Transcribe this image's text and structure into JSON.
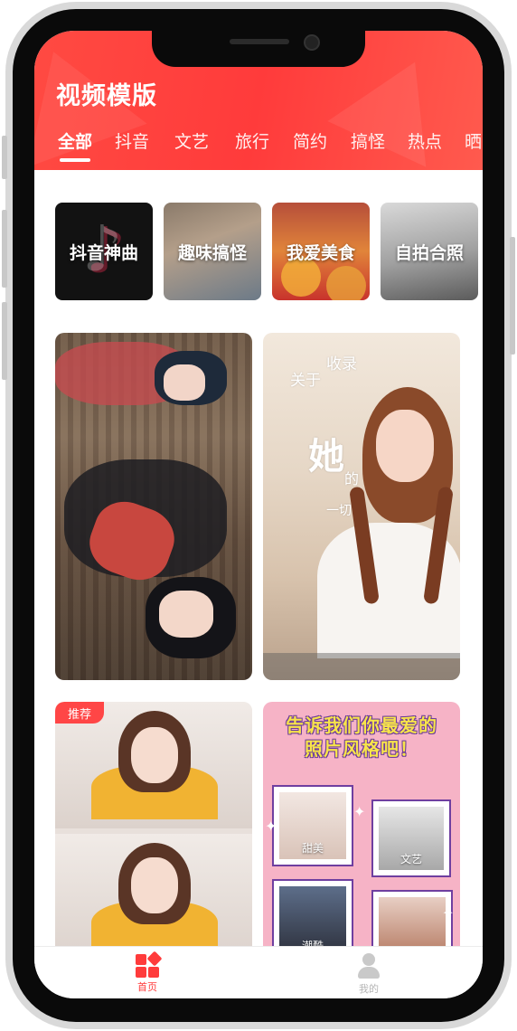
{
  "header": {
    "title": "视频模版",
    "tabs": [
      "全部",
      "抖音",
      "文艺",
      "旅行",
      "简约",
      "搞怪",
      "热点",
      "晒"
    ],
    "active_tab": "全部"
  },
  "categories": [
    {
      "label": "抖音神曲"
    },
    {
      "label": "趣味搞怪"
    },
    {
      "label": "我爱美食"
    },
    {
      "label": "自拍合照"
    }
  ],
  "templates": {
    "card2_text": [
      "关于",
      "收录",
      "她",
      "的",
      "一切"
    ],
    "card3_badge": "推荐",
    "card4_headline_line1": "告诉我们你最爱的",
    "card4_headline_line2": "照片风格吧！",
    "card4_styles": [
      "甜美",
      "文艺",
      "潮酷"
    ]
  },
  "tabbar": {
    "home_label": "首页",
    "me_label": "我的"
  },
  "colors": {
    "accent": "#ff3b3b",
    "inactive": "#b5b5b5"
  }
}
